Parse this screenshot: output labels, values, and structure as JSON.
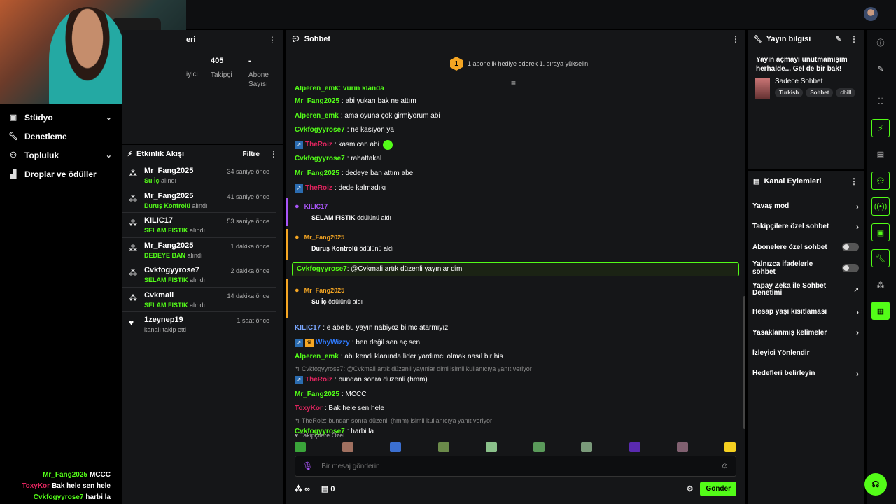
{
  "stats": {
    "title_partial": "eri",
    "label_partial": "iyici",
    "followers_value": "405",
    "followers_label": "Takipçi",
    "subs_value": "-",
    "subs_label": "Abone Sayısı"
  },
  "leftnav": [
    {
      "label": "Stüdyo",
      "icon": "studio-icon",
      "chevron": true
    },
    {
      "label": "Denetleme",
      "icon": "wrench-icon",
      "chevron": false
    },
    {
      "label": "Topluluk",
      "icon": "users-icon",
      "chevron": true
    },
    {
      "label": "Droplar ve ödüller",
      "icon": "chart-icon",
      "chevron": false
    }
  ],
  "overlay_chat": [
    {
      "user": "Mr_Fang2025",
      "color": "#53fc18",
      "text": "MCCC"
    },
    {
      "user": "ToxyKor",
      "color": "#e0245e",
      "text": "Bak hele sen hele"
    },
    {
      "user": "Cvkfogyyrose7",
      "color": "#53fc18",
      "text": "harbi la"
    }
  ],
  "events": {
    "title": "Etkinlik Akışı",
    "filter": "Filtre",
    "items": [
      {
        "name": "Mr_Fang2025",
        "item": "Su İç",
        "suffix": "alındı",
        "time": "34 saniye önce",
        "icon": "points-icon"
      },
      {
        "name": "Mr_Fang2025",
        "item": "Duruş Kontrolü",
        "suffix": "alındı",
        "time": "41 saniye önce",
        "icon": "points-icon"
      },
      {
        "name": "KILIC17",
        "item": "SELAM FISTIK",
        "suffix": "alındı",
        "time": "53 saniye önce",
        "icon": "points-icon"
      },
      {
        "name": "Mr_Fang2025",
        "item": "DEDEYE BAN",
        "suffix": "alındı",
        "time": "1 dakika önce",
        "icon": "points-icon"
      },
      {
        "name": "Cvkfogyyrose7",
        "item": "SELAM FISTIK",
        "suffix": "alındı",
        "time": "2 dakika önce",
        "icon": "points-icon"
      },
      {
        "name": "Cvkmali",
        "item": "SELAM FISTIK",
        "suffix": "alındı",
        "time": "14 dakika önce",
        "icon": "points-icon"
      },
      {
        "name": "1zeynep19",
        "item": "",
        "suffix": "kanalı takip etti",
        "time": "1 saat önce",
        "icon": "heart-icon"
      }
    ]
  },
  "chat": {
    "title": "Sohbet",
    "banner_badge": "1",
    "banner": "1 abonelik hediye ederek 1. sıraya yükselin",
    "partial_top": "Alperen_emk: vurin klanda",
    "followers_only_label": "Takipçilere Özel",
    "input_placeholder": "Bir mesaj gönderin",
    "points": "∞",
    "gifts_count": "0",
    "send_label": "Gönder",
    "highlight": {
      "user": "Cvkfogyyrose7",
      "text": "@Cvkmali artık düzenli yayınlar dimi"
    },
    "messages_a": [
      {
        "user": "Mr_Fang2025",
        "color": "#53fc18",
        "text": "abi yukarı bak ne attım",
        "badge": ""
      },
      {
        "user": "Alperen_emk",
        "color": "#53fc18",
        "text": "ama oyuna çok girmiyorum abi",
        "badge": ""
      },
      {
        "user": "Cvkfogyyrose7",
        "color": "#53fc18",
        "text": "ne kasıyon ya",
        "badge": ""
      },
      {
        "user": "TheRoiz",
        "color": "#e0245e",
        "text": "kasmican abi",
        "badge": "blue"
      },
      {
        "user": "Cvkfogyyrose7",
        "color": "#53fc18",
        "text": "rahattakal",
        "badge": ""
      },
      {
        "user": "Mr_Fang2025",
        "color": "#53fc18",
        "text": "dedeye ban attım abe",
        "badge": ""
      },
      {
        "user": "TheRoiz",
        "color": "#e0245e",
        "text": "dede kalmadıkı",
        "badge": "blue"
      }
    ],
    "gift1": {
      "user": "KILIC17",
      "item": "SELAM FISTIK",
      "suffix": "ödülünü aldı",
      "color": "#a855f7"
    },
    "gift2": {
      "user": "Mr_Fang2025",
      "item": "Duruş Kontrolü",
      "suffix": "ödülünü aldı",
      "color": "#f5a623"
    },
    "gift3": {
      "user": "Mr_Fang2025",
      "item": "Su İç",
      "suffix": "ödülünü aldı",
      "color": "#f5a623"
    },
    "messages_b": [
      {
        "user": "KILIC17",
        "color": "#7aa7ff",
        "text": "e abe bu yayın nabiyoz bi mc atarmıyız",
        "badge": ""
      },
      {
        "user": "WhyWizzy",
        "color": "#2f7bff",
        "text": "ben değil sen aç sen",
        "badge": "blue-gold"
      },
      {
        "user": "Alperen_emk",
        "color": "#53fc18",
        "text": "abi kendi klanında lider yardımcı olmak nasıl bir his",
        "badge": ""
      }
    ],
    "reply1": "↰ Cvkfogyyrose7: @Cvkmali artık düzenli yayınlar dimi isimli kullanıcıya yanıt veriyor",
    "messages_c": [
      {
        "user": "TheRoiz",
        "color": "#e0245e",
        "text": "bundan sonra düzenli (hmm)",
        "badge": "blue"
      },
      {
        "user": "Mr_Fang2025",
        "color": "#53fc18",
        "text": "MCCC",
        "badge": ""
      },
      {
        "user": "ToxyKor",
        "color": "#e0245e",
        "text": "Bak hele sen hele",
        "badge": ""
      }
    ],
    "reply2": "↰ TheRoiz: bundan sonra düzenli (hmm) isimli kullanıcıya yanıt veriyor",
    "messages_d": [
      {
        "user": "Cvkfogyyrose7",
        "color": "#53fc18",
        "text": "harbi la",
        "badge": ""
      }
    ]
  },
  "info": {
    "title": "Yayın bilgisi",
    "stream_title": "Yayın açmayı unutmamışım herhalde... Gel de bir bak!",
    "category": "Sadece Sohbet",
    "tags": [
      "Turkish",
      "Sohbet",
      "chill"
    ]
  },
  "actions": {
    "title": "Kanal Eylemleri",
    "items": [
      {
        "label": "Yavaş mod",
        "kind": "chevron"
      },
      {
        "label": "Takipçilere özel sohbet",
        "kind": "chevron"
      },
      {
        "label": "Abonelere özel sohbet",
        "kind": "toggle"
      },
      {
        "label": "Yalnızca ifadelerle sohbet",
        "kind": "toggle"
      },
      {
        "label": "Yapay Zeka ile Sohbet Denetimi",
        "kind": "external"
      },
      {
        "label": "Hesap yaşı kısıtlaması",
        "kind": "chevron"
      },
      {
        "label": "Yasaklanmış kelimeler",
        "kind": "chevron"
      },
      {
        "label": "İzleyici Yönlendir",
        "kind": "none"
      },
      {
        "label": "Hedefleri belirleyin",
        "kind": "chevron"
      }
    ]
  },
  "colors": {
    "accent": "#53fc18",
    "panel": "#151618"
  }
}
